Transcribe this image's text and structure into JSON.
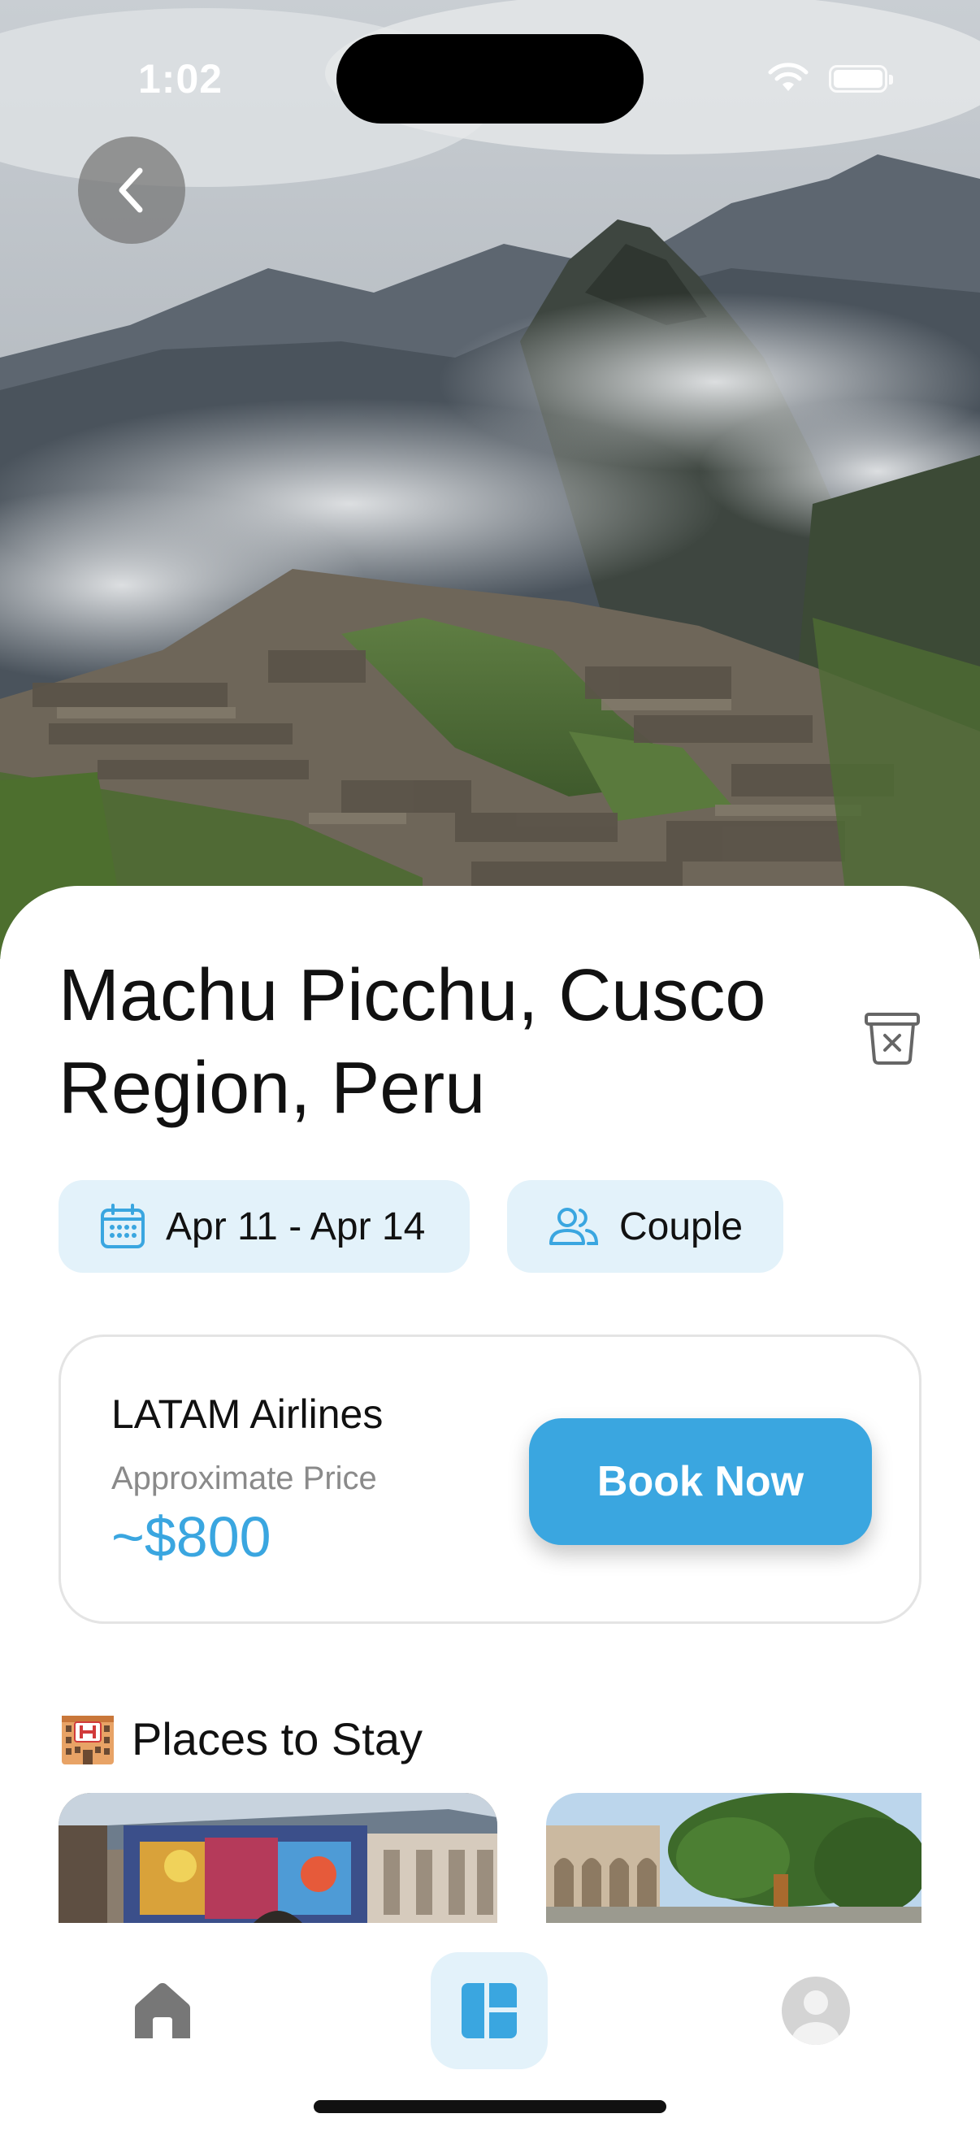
{
  "status_bar": {
    "time": "1:02"
  },
  "destination": {
    "title": "Machu Picchu, Cusco Region, Peru",
    "dates": "Apr 11 - Apr 14",
    "travelers": "Couple"
  },
  "flight": {
    "airline": "LATAM Airlines",
    "price_label": "Approximate Price",
    "price": "~$800",
    "book_label": "Book Now"
  },
  "stays": {
    "title": "Places to Stay"
  },
  "icons": {
    "back": "chevron-left-icon",
    "delete": "trash-icon",
    "calendar": "calendar-icon",
    "travelers": "people-icon",
    "hotel": "hotel-emoji-icon",
    "home_tab": "home-icon",
    "trips_tab": "dashboard-icon",
    "profile_tab": "profile-icon"
  },
  "colors": {
    "accent": "#3aa6e0",
    "chip_bg": "#e3f2fa",
    "text": "#111111",
    "muted": "#8a8a8a"
  }
}
